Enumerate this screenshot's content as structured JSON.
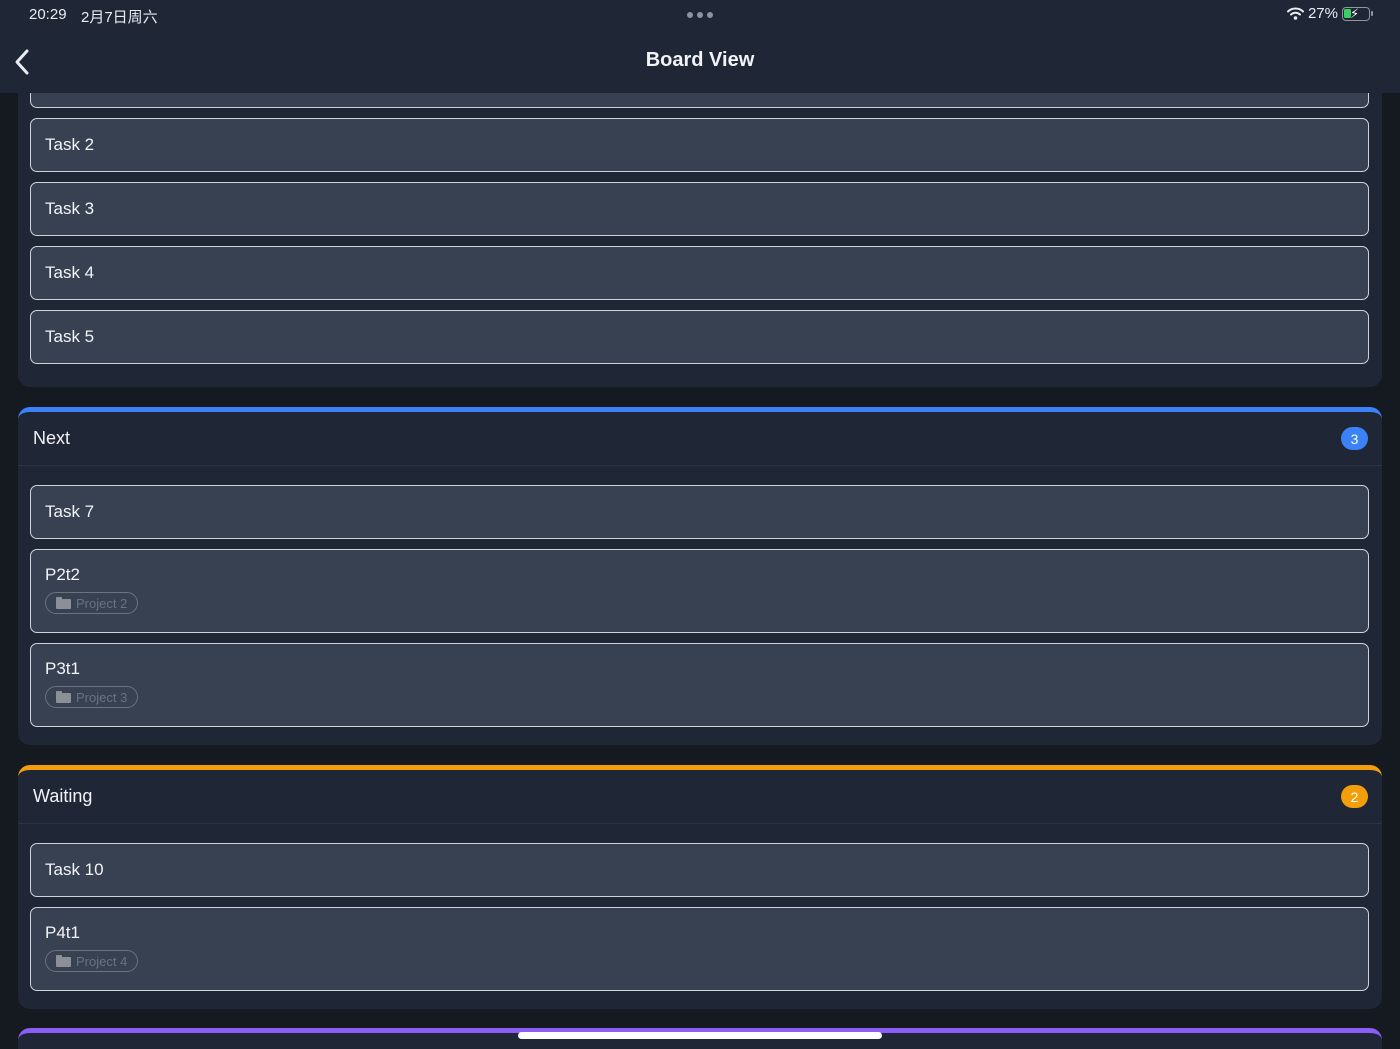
{
  "status_bar": {
    "time": "20:29",
    "date": "2月7日周六",
    "battery": "27%",
    "battery_level": 0.27,
    "icons": [
      "wifi-icon",
      "battery-charging-icon"
    ]
  },
  "nav": {
    "title": "Board View",
    "back_icon": "chevron-left-icon"
  },
  "columns": [
    {
      "title": "",
      "cards": [
        {
          "title": "Task 2"
        },
        {
          "title": "Task 3"
        },
        {
          "title": "Task 4"
        },
        {
          "title": "Task 5"
        }
      ]
    },
    {
      "title": "Next",
      "count": "3",
      "accent": "#3b82f6",
      "cards": [
        {
          "title": "Task 7"
        },
        {
          "title": "P2t2",
          "project": "Project 2"
        },
        {
          "title": "P3t1",
          "project": "Project 3"
        }
      ]
    },
    {
      "title": "Waiting",
      "count": "2",
      "accent": "#f59e0b",
      "cards": [
        {
          "title": "Task 10"
        },
        {
          "title": "P4t1",
          "project": "Project 4"
        }
      ]
    },
    {
      "accent": "#8b5cf6"
    }
  ],
  "colors": {
    "background": "#151a21",
    "column": "#1f2736",
    "card": "#374151"
  }
}
